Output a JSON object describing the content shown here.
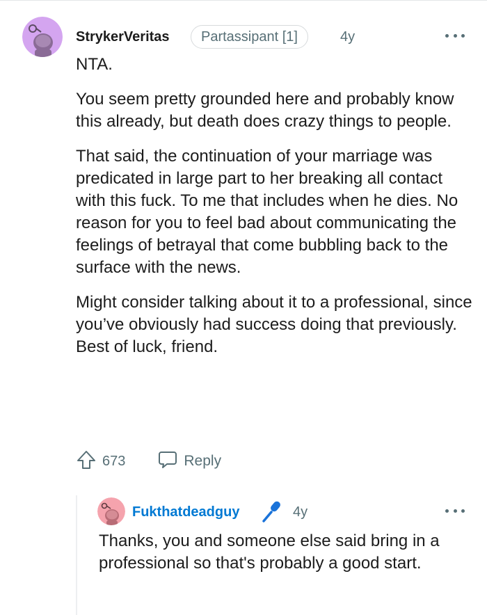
{
  "comment": {
    "username": "StrykerVeritas",
    "flair": "Partassipant [1]",
    "age": "4y",
    "paragraphs": [
      "NTA.",
      "You seem pretty grounded here and probably know this already, but death does crazy things to people.",
      "That said, the continuation of your marriage was predicated in large part to her breaking all contact with this fuck. To me that includes when he dies. No reason for you to feel bad about communicating the feelings of betrayal that come bubbling back to the surface with the news.",
      "Might consider talking about it to a professional, since you’ve obviously had success doing that previously. Best of luck, friend."
    ],
    "upvotes": "673",
    "reply_label": "Reply",
    "avatar_color": "#d4a5f0"
  },
  "reply": {
    "username": "Fukthatdeadguy",
    "age": "4y",
    "text": "Thanks, you and someone else said bring in a professional so that's probably a good start.",
    "avatar_color": "#f5a3ad",
    "username_color": "#0079d3"
  },
  "icons": {
    "more": "more-options-icon",
    "upvote": "upvote-arrow-icon",
    "reply": "speech-bubble-icon",
    "mic": "microphone-icon"
  }
}
